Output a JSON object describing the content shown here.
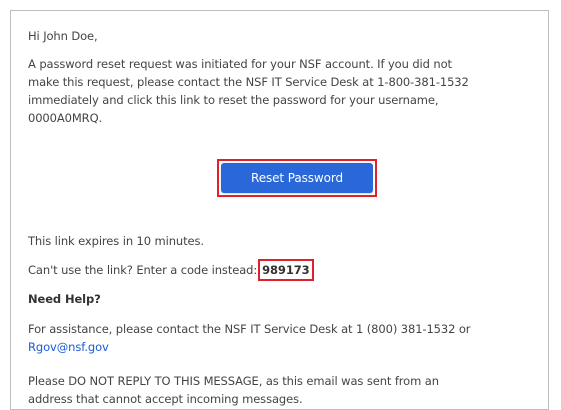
{
  "email": {
    "greeting": "Hi John Doe,",
    "intro_lines": [
      "A password reset request was initiated for your NSF account. If you did not",
      "make this request, please contact the NSF IT Service Desk at 1-800-381-1532",
      "immediately and click this link to reset the password for your username,",
      "0000A0MRQ."
    ],
    "reset_button_label": "Reset Password",
    "expires_text": "This link expires in 10 minutes.",
    "code_prompt": "Can't use the link? Enter a code instead:",
    "code": "989173",
    "need_help_heading": "Need Help?",
    "assist_line_1": "For assistance, please contact the NSF IT Service Desk at 1 (800) 381-1532 or",
    "assist_email": "Rgov@nsf.gov",
    "reply_lines": [
      "Please DO NOT REPLY TO THIS MESSAGE, as this email was sent from an",
      "address that cannot accept incoming messages."
    ]
  },
  "colors": {
    "button_bg": "#2a67d8",
    "highlight_border": "#e0202a",
    "link": "#1a5bd6",
    "text": "#444444"
  }
}
